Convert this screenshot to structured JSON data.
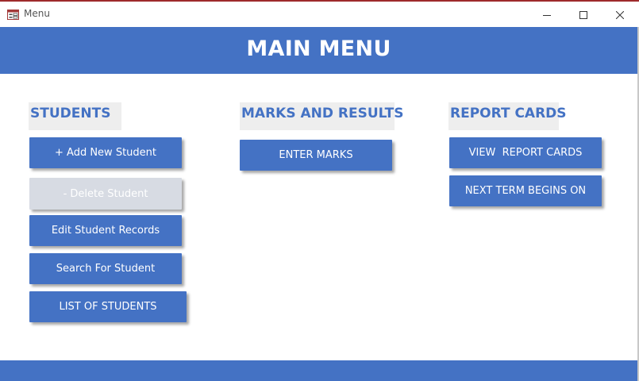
{
  "window": {
    "title": "Menu",
    "icon": "form-icon"
  },
  "header": {
    "title": "MAIN MENU"
  },
  "sections": {
    "students": {
      "heading": "STUDENTS",
      "buttons": {
        "add": "+ Add New Student",
        "delete": "- Delete Student",
        "edit": "Edit Student Records",
        "search": "Search For Student",
        "list": "LIST OF STUDENTS"
      }
    },
    "marks": {
      "heading": "MARKS AND RESULTS",
      "buttons": {
        "enter": "ENTER MARKS"
      }
    },
    "reports": {
      "heading": "REPORT CARDS",
      "buttons": {
        "view": "VIEW  REPORT CARDS",
        "next_term": "NEXT TERM BEGINS ON"
      }
    }
  },
  "colors": {
    "accent": "#4472c4",
    "heading_bg": "#eeeeee",
    "disabled_button": "#d7dbe3",
    "titlebar_top_line": "#9e2a2b"
  },
  "states": {
    "delete_button_disabled": true
  }
}
